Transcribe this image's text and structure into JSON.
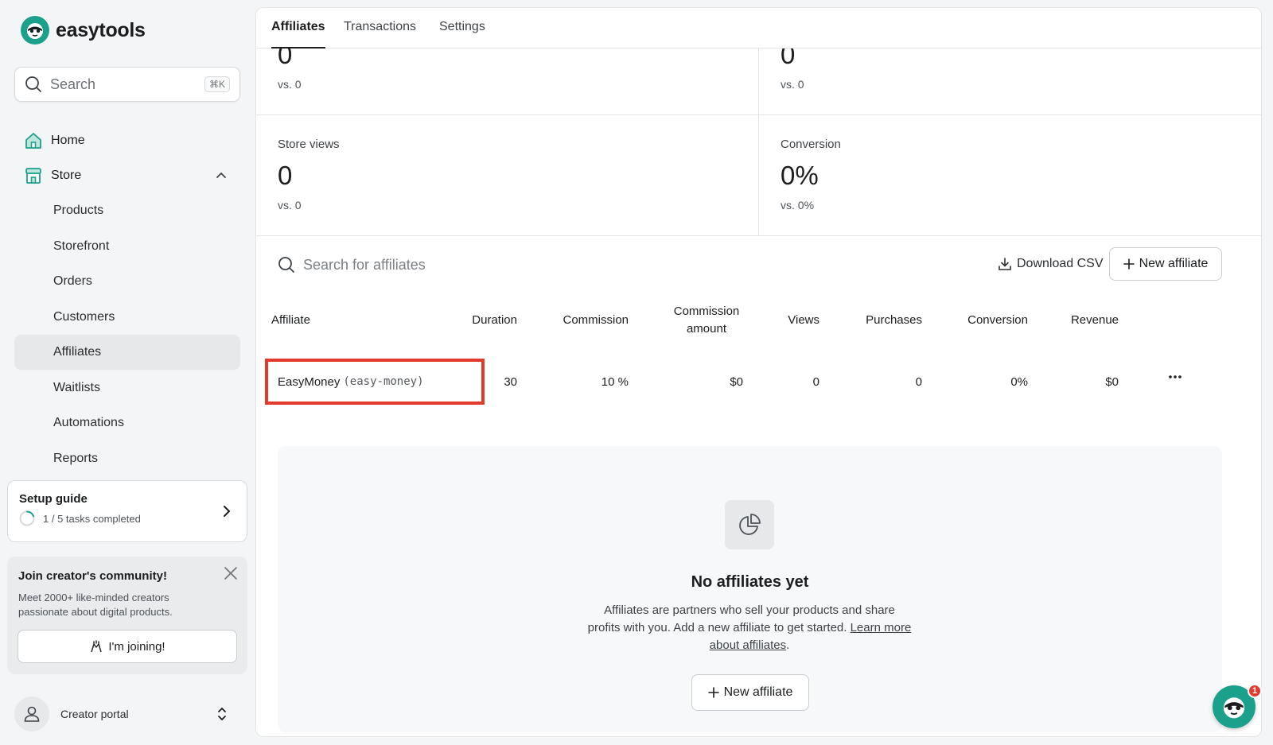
{
  "app": {
    "name": "easytools",
    "brand_color": "#1ba08b"
  },
  "sidebar": {
    "search": {
      "placeholder": "Search",
      "shortcut": "⌘K"
    },
    "home_label": "Home",
    "store_label": "Store",
    "store_items": [
      {
        "label": "Products"
      },
      {
        "label": "Storefront"
      },
      {
        "label": "Orders"
      },
      {
        "label": "Customers"
      },
      {
        "label": "Affiliates",
        "active": true
      },
      {
        "label": "Waitlists"
      },
      {
        "label": "Automations"
      },
      {
        "label": "Reports"
      }
    ],
    "setup_guide": {
      "title": "Setup guide",
      "progress_text": "1 / 5 tasks completed",
      "completed": 1,
      "total": 5
    },
    "community": {
      "title": "Join creator's community!",
      "description": "Meet 2000+ like-minded creators passionate about digital products.",
      "button_label": "I'm joining!"
    },
    "portal_label": "Creator portal"
  },
  "tabs": [
    {
      "label": "Affiliates",
      "active": true
    },
    {
      "label": "Transactions"
    },
    {
      "label": "Settings"
    }
  ],
  "stats": [
    {
      "label": "",
      "value": "0",
      "vs": "vs. 0"
    },
    {
      "label": "",
      "value": "0",
      "vs": "vs. 0"
    },
    {
      "label": "Store views",
      "value": "0",
      "vs": "vs. 0"
    },
    {
      "label": "Conversion",
      "value": "0%",
      "vs": "vs. 0%"
    }
  ],
  "toolbar": {
    "search_placeholder": "Search for affiliates",
    "download_label": "Download CSV",
    "new_affiliate_label": "New affiliate"
  },
  "table": {
    "headers": {
      "affiliate": "Affiliate",
      "duration": "Duration",
      "commission": "Commission",
      "commission_amount_1": "Commission",
      "commission_amount_2": "amount",
      "views": "Views",
      "purchases": "Purchases",
      "conversion": "Conversion",
      "revenue": "Revenue"
    },
    "rows": [
      {
        "name": "EasyMoney",
        "slug": "(easy-money)",
        "duration": "30",
        "commission": "10 %",
        "commission_amount": "$0",
        "views": "0",
        "purchases": "0",
        "conversion": "0%",
        "revenue": "$0"
      }
    ]
  },
  "empty_state": {
    "title": "No affiliates yet",
    "description": "Affiliates are partners who sell your products and share profits with you. Add a new affiliate to get started.",
    "link_text": "Learn more about affiliates",
    "period": ".",
    "button_label": "New affiliate"
  },
  "chat": {
    "badge_count": "1"
  }
}
